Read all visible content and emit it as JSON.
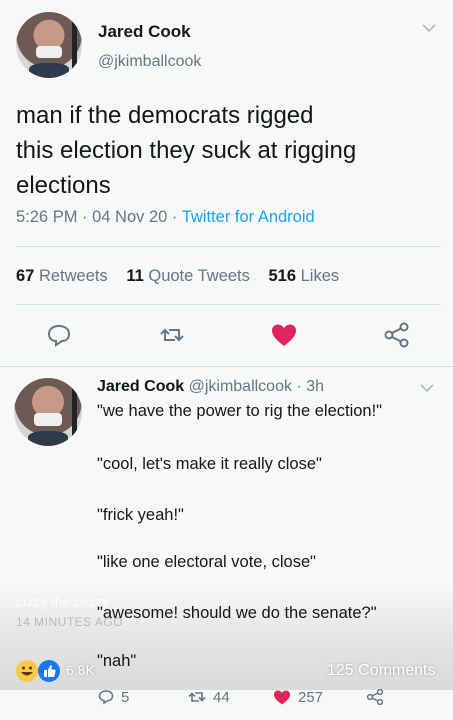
{
  "tweet": {
    "author_name": "Jared Cook",
    "author_handle": "@jkimballcook",
    "text_lines": [
      "man if the democrats rigged",
      "this election they suck at rigging",
      "elections"
    ],
    "meta": {
      "time": "5:26 PM",
      "sep1": " · ",
      "date": "04 Nov 20",
      "sep2": " · ",
      "client": "Twitter for Android"
    },
    "stats": {
      "retweets_count": "67",
      "retweets_label": "Retweets",
      "quotes_count": "11",
      "quotes_label": "Quote Tweets",
      "likes_count": "516",
      "likes_label": "Likes"
    }
  },
  "reply": {
    "author_name": "Jared Cook",
    "author_handle": "@jkimballcook",
    "age": " · 3h",
    "lines": [
      "\"we have the power to rig the election!\"",
      "\"cool, let's make it really close\"",
      "\"frick yeah!\"",
      "\"like one electoral vote, close\"",
      "\"awesome! should we do the senate?\"",
      "\"nah\""
    ],
    "reply_count": "5",
    "retweet_count": "44",
    "like_count": "257"
  },
  "overlay": {
    "poster_name": "Lizzy the Lezzy",
    "posted_ago": "14 MINUTES AGO",
    "reaction_count": "6.8K",
    "comments_label": "125 Comments"
  },
  "colors": {
    "accent": "#1da1f2",
    "like": "#e0245e",
    "muted": "#657786",
    "background": "#f7f8f8"
  },
  "icons": [
    "chevron-down-icon",
    "reply-icon",
    "retweet-icon",
    "heart-icon",
    "share-icon",
    "laugh-reaction-icon",
    "like-reaction-icon"
  ]
}
